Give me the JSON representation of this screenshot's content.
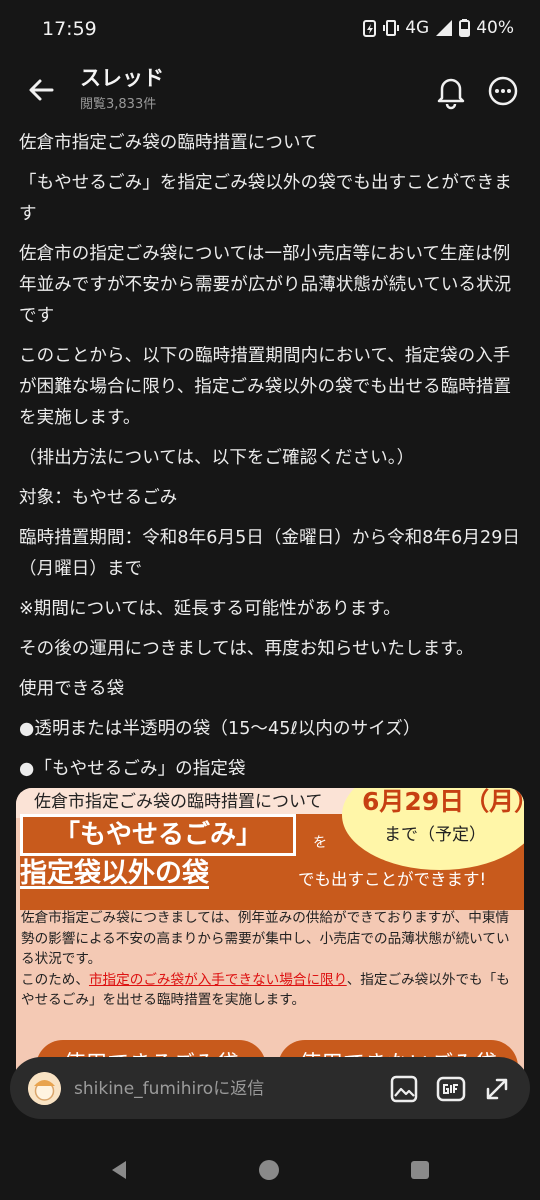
{
  "status": {
    "time": "17:59",
    "network": "4G",
    "battery": "40%"
  },
  "header": {
    "title": "スレッド",
    "views": "閲覧3,833件"
  },
  "post": {
    "paragraphs": [
      "佐倉市指定ごみ袋の臨時措置について",
      "「もやせるごみ」を指定ごみ袋以外の袋でも出すことができます",
      "佐倉市の指定ごみ袋については一部小売店等において生産は例年並みですが不安から需要が広がり品薄状態が続いている状況です",
      "このことから、以下の臨時措置期間内において、指定袋の入手が困難な場合に限り、指定ごみ袋以外の袋でも出せる臨時措置を実施します。",
      "（排出方法については、以下をご確認ください。）",
      "対象：もやせるごみ",
      "臨時措置期間：令和8年6月5日（金曜日）から令和8年6月29日（月曜日）まで",
      "※期間については、延長する可能性があります。",
      "その後の運用につきましては、再度お知らせいたします。",
      "使用できる袋",
      "●透明または半透明の袋（15～45ℓ以内のサイズ）",
      "●「もやせるごみ」の指定袋"
    ]
  },
  "poster": {
    "heading": "佐倉市指定ごみ袋の臨時措置について",
    "date": "6月29日（月）",
    "until": "まで（予定）",
    "moyaseru": "「もやせるごみ」",
    "wo": "を",
    "shitei": "指定袋以外の袋",
    "demo": "でも出すことができます!",
    "body1": "佐倉市指定ごみ袋につきましては、例年並みの供給ができておりますが、中東情勢の影響による不安の高まりから需要が集中し、小売店での品薄状態が続いている状況です。",
    "body2_pre": "このため、",
    "body2_red": "市指定のごみ袋が入手できない場合に限り",
    "body2_post": "、指定ごみ袋以外でも「もやせるごみ」を出せる臨時措置を実施します。",
    "btn_ok": "使用できるごみ袋",
    "btn_ng": "使用できないごみ袋"
  },
  "reply": {
    "placeholder": "shikine_fumihiroに返信"
  },
  "colors": {
    "background": "#161616",
    "poster_orange": "#c85a1c",
    "poster_pink": "#f4c9b4",
    "date_red": "#c64012"
  },
  "icons": [
    "back-arrow-icon",
    "bell-icon",
    "more-icon",
    "image-icon",
    "gif-icon",
    "expand-icon",
    "nav-back-icon",
    "nav-home-icon",
    "nav-recents-icon"
  ]
}
